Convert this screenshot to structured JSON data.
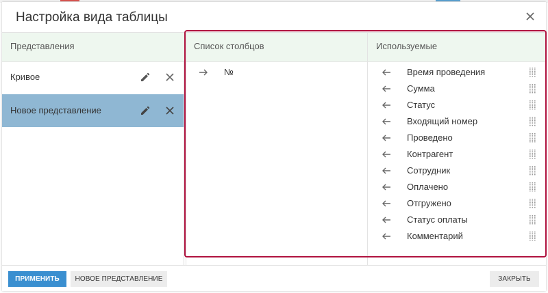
{
  "dialog": {
    "title": "Настройка вида таблицы"
  },
  "views_panel": {
    "title": "Представления",
    "items": [
      {
        "label": "Кривое",
        "selected": false
      },
      {
        "label": "Новое представление",
        "selected": true
      }
    ]
  },
  "columns_panel": {
    "title": "Список столбцов",
    "items": [
      {
        "label": "№",
        "arrow": "arrow-right-icon"
      }
    ]
  },
  "used_panel": {
    "title": "Используемые",
    "items": [
      {
        "label": "Время проведения"
      },
      {
        "label": "Сумма"
      },
      {
        "label": "Статус"
      },
      {
        "label": "Входящий номер"
      },
      {
        "label": "Проведено"
      },
      {
        "label": "Контрагент"
      },
      {
        "label": "Сотрудник"
      },
      {
        "label": "Оплачено"
      },
      {
        "label": "Отгружено"
      },
      {
        "label": "Статус оплаты"
      },
      {
        "label": "Комментарий"
      }
    ]
  },
  "footer": {
    "apply_label": "ПРИМЕНИТЬ",
    "new_view_label": "НОВОЕ ПРЕДСТАВЛЕНИЕ",
    "close_label": "ЗАКРЫТЬ"
  },
  "colors": {
    "header_band": "#eef7ef",
    "selected_row": "#8fb7d3",
    "primary_button": "#3a8fd0",
    "highlight_frame": "#b0123f"
  }
}
